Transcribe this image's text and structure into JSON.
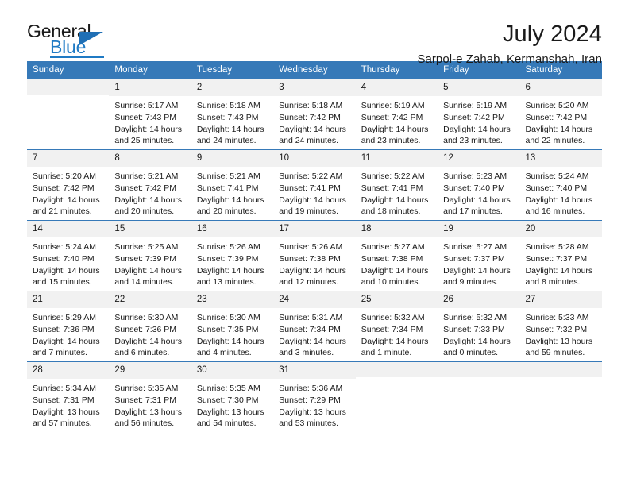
{
  "logo": {
    "word_dark": "General",
    "word_blue": "Blue",
    "triangle_icon": "triangle-icon",
    "brand_color": "#1f7ac4"
  },
  "header": {
    "title": "July 2024",
    "subtitle": "Sarpol-e Zahab, Kermanshah, Iran",
    "accent_color": "#3679b8",
    "daynum_bg": "#f1f1f1"
  },
  "weekday_headers": [
    "Sunday",
    "Monday",
    "Tuesday",
    "Wednesday",
    "Thursday",
    "Friday",
    "Saturday"
  ],
  "weeks": [
    [
      {
        "day": "",
        "sunrise": "",
        "sunset": "",
        "daylight_line1": "",
        "daylight_line2": ""
      },
      {
        "day": "1",
        "sunrise": "Sunrise: 5:17 AM",
        "sunset": "Sunset: 7:43 PM",
        "daylight_line1": "Daylight: 14 hours",
        "daylight_line2": "and 25 minutes."
      },
      {
        "day": "2",
        "sunrise": "Sunrise: 5:18 AM",
        "sunset": "Sunset: 7:43 PM",
        "daylight_line1": "Daylight: 14 hours",
        "daylight_line2": "and 24 minutes."
      },
      {
        "day": "3",
        "sunrise": "Sunrise: 5:18 AM",
        "sunset": "Sunset: 7:42 PM",
        "daylight_line1": "Daylight: 14 hours",
        "daylight_line2": "and 24 minutes."
      },
      {
        "day": "4",
        "sunrise": "Sunrise: 5:19 AM",
        "sunset": "Sunset: 7:42 PM",
        "daylight_line1": "Daylight: 14 hours",
        "daylight_line2": "and 23 minutes."
      },
      {
        "day": "5",
        "sunrise": "Sunrise: 5:19 AM",
        "sunset": "Sunset: 7:42 PM",
        "daylight_line1": "Daylight: 14 hours",
        "daylight_line2": "and 23 minutes."
      },
      {
        "day": "6",
        "sunrise": "Sunrise: 5:20 AM",
        "sunset": "Sunset: 7:42 PM",
        "daylight_line1": "Daylight: 14 hours",
        "daylight_line2": "and 22 minutes."
      }
    ],
    [
      {
        "day": "7",
        "sunrise": "Sunrise: 5:20 AM",
        "sunset": "Sunset: 7:42 PM",
        "daylight_line1": "Daylight: 14 hours",
        "daylight_line2": "and 21 minutes."
      },
      {
        "day": "8",
        "sunrise": "Sunrise: 5:21 AM",
        "sunset": "Sunset: 7:42 PM",
        "daylight_line1": "Daylight: 14 hours",
        "daylight_line2": "and 20 minutes."
      },
      {
        "day": "9",
        "sunrise": "Sunrise: 5:21 AM",
        "sunset": "Sunset: 7:41 PM",
        "daylight_line1": "Daylight: 14 hours",
        "daylight_line2": "and 20 minutes."
      },
      {
        "day": "10",
        "sunrise": "Sunrise: 5:22 AM",
        "sunset": "Sunset: 7:41 PM",
        "daylight_line1": "Daylight: 14 hours",
        "daylight_line2": "and 19 minutes."
      },
      {
        "day": "11",
        "sunrise": "Sunrise: 5:22 AM",
        "sunset": "Sunset: 7:41 PM",
        "daylight_line1": "Daylight: 14 hours",
        "daylight_line2": "and 18 minutes."
      },
      {
        "day": "12",
        "sunrise": "Sunrise: 5:23 AM",
        "sunset": "Sunset: 7:40 PM",
        "daylight_line1": "Daylight: 14 hours",
        "daylight_line2": "and 17 minutes."
      },
      {
        "day": "13",
        "sunrise": "Sunrise: 5:24 AM",
        "sunset": "Sunset: 7:40 PM",
        "daylight_line1": "Daylight: 14 hours",
        "daylight_line2": "and 16 minutes."
      }
    ],
    [
      {
        "day": "14",
        "sunrise": "Sunrise: 5:24 AM",
        "sunset": "Sunset: 7:40 PM",
        "daylight_line1": "Daylight: 14 hours",
        "daylight_line2": "and 15 minutes."
      },
      {
        "day": "15",
        "sunrise": "Sunrise: 5:25 AM",
        "sunset": "Sunset: 7:39 PM",
        "daylight_line1": "Daylight: 14 hours",
        "daylight_line2": "and 14 minutes."
      },
      {
        "day": "16",
        "sunrise": "Sunrise: 5:26 AM",
        "sunset": "Sunset: 7:39 PM",
        "daylight_line1": "Daylight: 14 hours",
        "daylight_line2": "and 13 minutes."
      },
      {
        "day": "17",
        "sunrise": "Sunrise: 5:26 AM",
        "sunset": "Sunset: 7:38 PM",
        "daylight_line1": "Daylight: 14 hours",
        "daylight_line2": "and 12 minutes."
      },
      {
        "day": "18",
        "sunrise": "Sunrise: 5:27 AM",
        "sunset": "Sunset: 7:38 PM",
        "daylight_line1": "Daylight: 14 hours",
        "daylight_line2": "and 10 minutes."
      },
      {
        "day": "19",
        "sunrise": "Sunrise: 5:27 AM",
        "sunset": "Sunset: 7:37 PM",
        "daylight_line1": "Daylight: 14 hours",
        "daylight_line2": "and 9 minutes."
      },
      {
        "day": "20",
        "sunrise": "Sunrise: 5:28 AM",
        "sunset": "Sunset: 7:37 PM",
        "daylight_line1": "Daylight: 14 hours",
        "daylight_line2": "and 8 minutes."
      }
    ],
    [
      {
        "day": "21",
        "sunrise": "Sunrise: 5:29 AM",
        "sunset": "Sunset: 7:36 PM",
        "daylight_line1": "Daylight: 14 hours",
        "daylight_line2": "and 7 minutes."
      },
      {
        "day": "22",
        "sunrise": "Sunrise: 5:30 AM",
        "sunset": "Sunset: 7:36 PM",
        "daylight_line1": "Daylight: 14 hours",
        "daylight_line2": "and 6 minutes."
      },
      {
        "day": "23",
        "sunrise": "Sunrise: 5:30 AM",
        "sunset": "Sunset: 7:35 PM",
        "daylight_line1": "Daylight: 14 hours",
        "daylight_line2": "and 4 minutes."
      },
      {
        "day": "24",
        "sunrise": "Sunrise: 5:31 AM",
        "sunset": "Sunset: 7:34 PM",
        "daylight_line1": "Daylight: 14 hours",
        "daylight_line2": "and 3 minutes."
      },
      {
        "day": "25",
        "sunrise": "Sunrise: 5:32 AM",
        "sunset": "Sunset: 7:34 PM",
        "daylight_line1": "Daylight: 14 hours",
        "daylight_line2": "and 1 minute."
      },
      {
        "day": "26",
        "sunrise": "Sunrise: 5:32 AM",
        "sunset": "Sunset: 7:33 PM",
        "daylight_line1": "Daylight: 14 hours",
        "daylight_line2": "and 0 minutes."
      },
      {
        "day": "27",
        "sunrise": "Sunrise: 5:33 AM",
        "sunset": "Sunset: 7:32 PM",
        "daylight_line1": "Daylight: 13 hours",
        "daylight_line2": "and 59 minutes."
      }
    ],
    [
      {
        "day": "28",
        "sunrise": "Sunrise: 5:34 AM",
        "sunset": "Sunset: 7:31 PM",
        "daylight_line1": "Daylight: 13 hours",
        "daylight_line2": "and 57 minutes."
      },
      {
        "day": "29",
        "sunrise": "Sunrise: 5:35 AM",
        "sunset": "Sunset: 7:31 PM",
        "daylight_line1": "Daylight: 13 hours",
        "daylight_line2": "and 56 minutes."
      },
      {
        "day": "30",
        "sunrise": "Sunrise: 5:35 AM",
        "sunset": "Sunset: 7:30 PM",
        "daylight_line1": "Daylight: 13 hours",
        "daylight_line2": "and 54 minutes."
      },
      {
        "day": "31",
        "sunrise": "Sunrise: 5:36 AM",
        "sunset": "Sunset: 7:29 PM",
        "daylight_line1": "Daylight: 13 hours",
        "daylight_line2": "and 53 minutes."
      },
      {
        "day": "",
        "sunrise": "",
        "sunset": "",
        "daylight_line1": "",
        "daylight_line2": ""
      },
      {
        "day": "",
        "sunrise": "",
        "sunset": "",
        "daylight_line1": "",
        "daylight_line2": ""
      },
      {
        "day": "",
        "sunrise": "",
        "sunset": "",
        "daylight_line1": "",
        "daylight_line2": ""
      }
    ]
  ]
}
